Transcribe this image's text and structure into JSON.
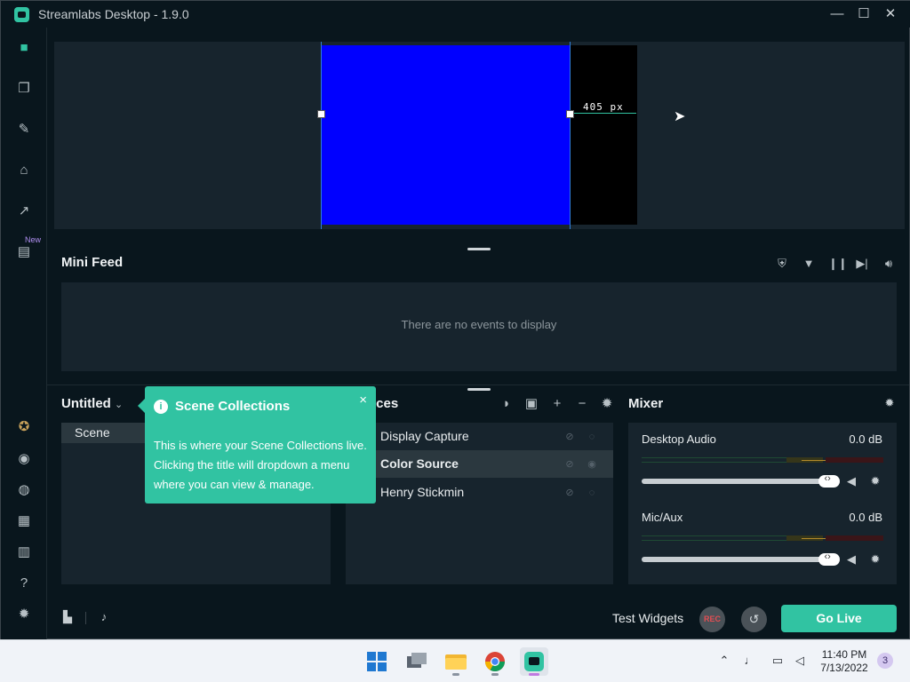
{
  "window": {
    "title": "Streamlabs Desktop - 1.9.0"
  },
  "nav": {
    "items": [
      {
        "name": "editor-icon"
      },
      {
        "name": "layers-icon"
      },
      {
        "name": "themes-icon"
      },
      {
        "name": "store-icon"
      },
      {
        "name": "analytics-icon"
      },
      {
        "name": "highlighter-icon"
      }
    ],
    "new_badge": "New",
    "bottom_items": [
      {
        "name": "prime-icon"
      },
      {
        "name": "dashboard-icon"
      },
      {
        "name": "chat-icon"
      },
      {
        "name": "apps-icon"
      },
      {
        "name": "layout-icon"
      },
      {
        "name": "help-icon"
      },
      {
        "name": "settings-icon"
      }
    ]
  },
  "preview": {
    "measure_label": "405 px"
  },
  "mini_feed": {
    "title": "Mini Feed",
    "empty_text": "There are no events to display"
  },
  "scenes": {
    "collection_title": "Untitled",
    "items": [
      "Scene"
    ]
  },
  "sources": {
    "title_partial": "ces",
    "items": [
      {
        "name": "Display Capture",
        "selected": false
      },
      {
        "name": "Color Source",
        "selected": true
      },
      {
        "name": "Henry Stickmin",
        "selected": false
      }
    ]
  },
  "mixer": {
    "title": "Mixer",
    "channels": [
      {
        "name": "Desktop Audio",
        "db": "0.0 dB",
        "level": 0.97
      },
      {
        "name": "Mic/Aux",
        "db": "0.0 dB",
        "level": 0.97
      }
    ]
  },
  "tooltip": {
    "title": "Scene Collections",
    "body": "This is where your Scene Collections live. Clicking the title will dropdown a menu where you can view & manage.",
    "close": "×",
    "info": "i"
  },
  "footer": {
    "test_widgets": "Test Widgets",
    "rec": "REC",
    "go_live": "Go Live"
  },
  "taskbar": {
    "time": "11:40 PM",
    "date": "7/13/2022",
    "notifications": "3"
  },
  "colors": {
    "accent": "#31c3a2",
    "color_source": "#0000ff",
    "background": "#09161d",
    "panel": "#17242d"
  }
}
